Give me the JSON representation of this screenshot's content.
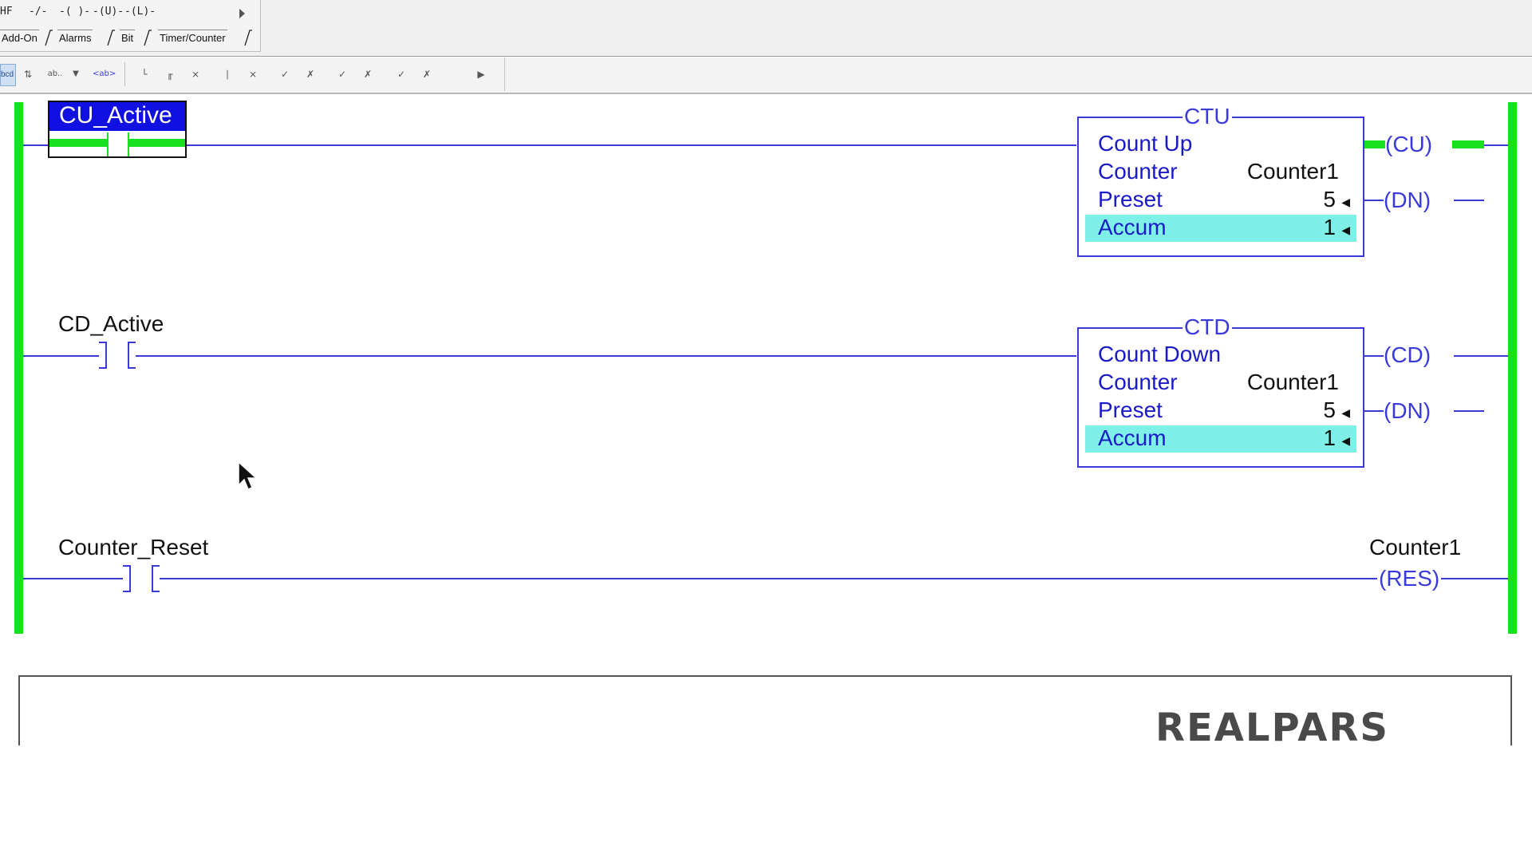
{
  "palette": {
    "instructions": [
      "HF",
      "-/-",
      "-( )-",
      "-(U)-",
      "-(L)-"
    ],
    "tabs": [
      "Add-On",
      "Alarms",
      "Bit",
      "Timer/Counter"
    ]
  },
  "toolbar": {
    "selected_label": "bcd",
    "icons": [
      "expand-branch-icon",
      "move-up-icon",
      "ab-dropdown-icon",
      "dropdown-arrow-icon",
      "ab-symbol-icon",
      "rung-icon",
      "branch-icon",
      "delete-branch-icon",
      "branch-level-icon",
      "delete-level-icon",
      "verify-rung-icon",
      "verify-delete-icon",
      "accept-edits-icon",
      "cancel-edits-icon",
      "assemble-icon",
      "cancel-assemble-icon",
      "test-edits-icon"
    ]
  },
  "rungs": {
    "rung0": {
      "contact_tag": "CU_Active",
      "block": {
        "title": "CTU",
        "name": "Count Up",
        "counter_label": "Counter",
        "counter_value": "Counter1",
        "preset_label": "Preset",
        "preset_value": "5",
        "accum_label": "Accum",
        "accum_value": "1"
      },
      "coils": [
        "CU",
        "DN"
      ]
    },
    "rung1": {
      "contact_tag": "CD_Active",
      "block": {
        "title": "CTD",
        "name": "Count Down",
        "counter_label": "Counter",
        "counter_value": "Counter1",
        "preset_label": "Preset",
        "preset_value": "5",
        "accum_label": "Accum",
        "accum_value": "1"
      },
      "coils": [
        "CD",
        "DN"
      ]
    },
    "rung2": {
      "contact_tag": "Counter_Reset",
      "coil_tag": "Counter1",
      "coil": "RES"
    }
  },
  "logo": "REALPARS",
  "colors": {
    "rail_green": "#19e01e",
    "wire_blue": "#3a3adb",
    "highlight_cyan": "#7ff0e8",
    "selection_blue": "#1010e0"
  }
}
